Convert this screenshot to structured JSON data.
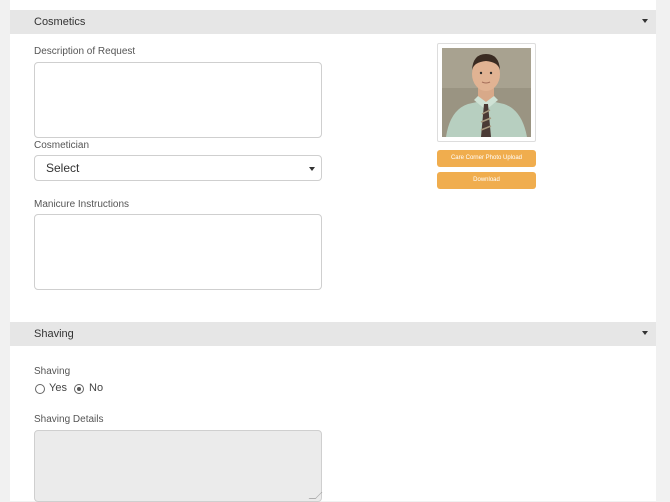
{
  "cosmetics": {
    "title": "Cosmetics",
    "description_label": "Description of Request",
    "description_value": "",
    "cosmetician_label": "Cosmetician",
    "cosmetician_selected": "Select",
    "manicure_label": "Manicure Instructions",
    "manicure_value": "",
    "photo_upload_button": "Care Corner Photo Upload",
    "download_button": "Download"
  },
  "shaving": {
    "title": "Shaving",
    "shaving_label": "Shaving",
    "options": [
      "Yes",
      "No"
    ],
    "selected": "No",
    "details_label": "Shaving Details",
    "details_value": ""
  },
  "colors": {
    "accent": "#f0ad4e",
    "header_bg": "#e6e6e6"
  }
}
